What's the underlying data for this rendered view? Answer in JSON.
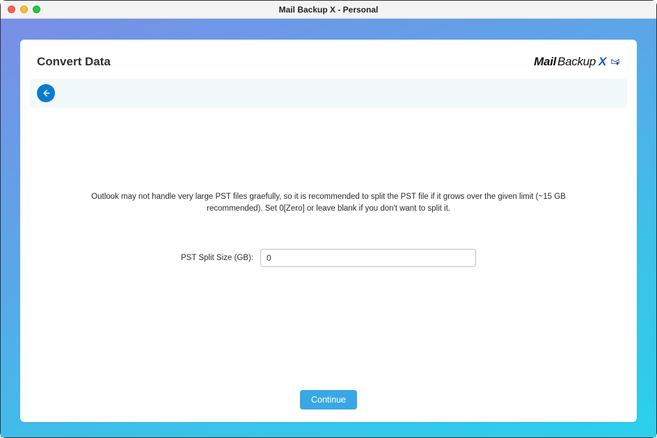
{
  "window": {
    "title": "Mail Backup X - Personal"
  },
  "header": {
    "page_title": "Convert Data",
    "logo": {
      "mail": "Mail",
      "backup": "Backup",
      "x": "X"
    }
  },
  "content": {
    "description": "Outlook may not handle very large PST files graefully, so it is recommended to split the PST file if it grows over the given limit (~15 GB recommended). Set 0[Zero] or leave blank if you don't want to split it.",
    "field_label": "PST Split Size (GB):",
    "field_value": "0"
  },
  "footer": {
    "continue_label": "Continue"
  }
}
